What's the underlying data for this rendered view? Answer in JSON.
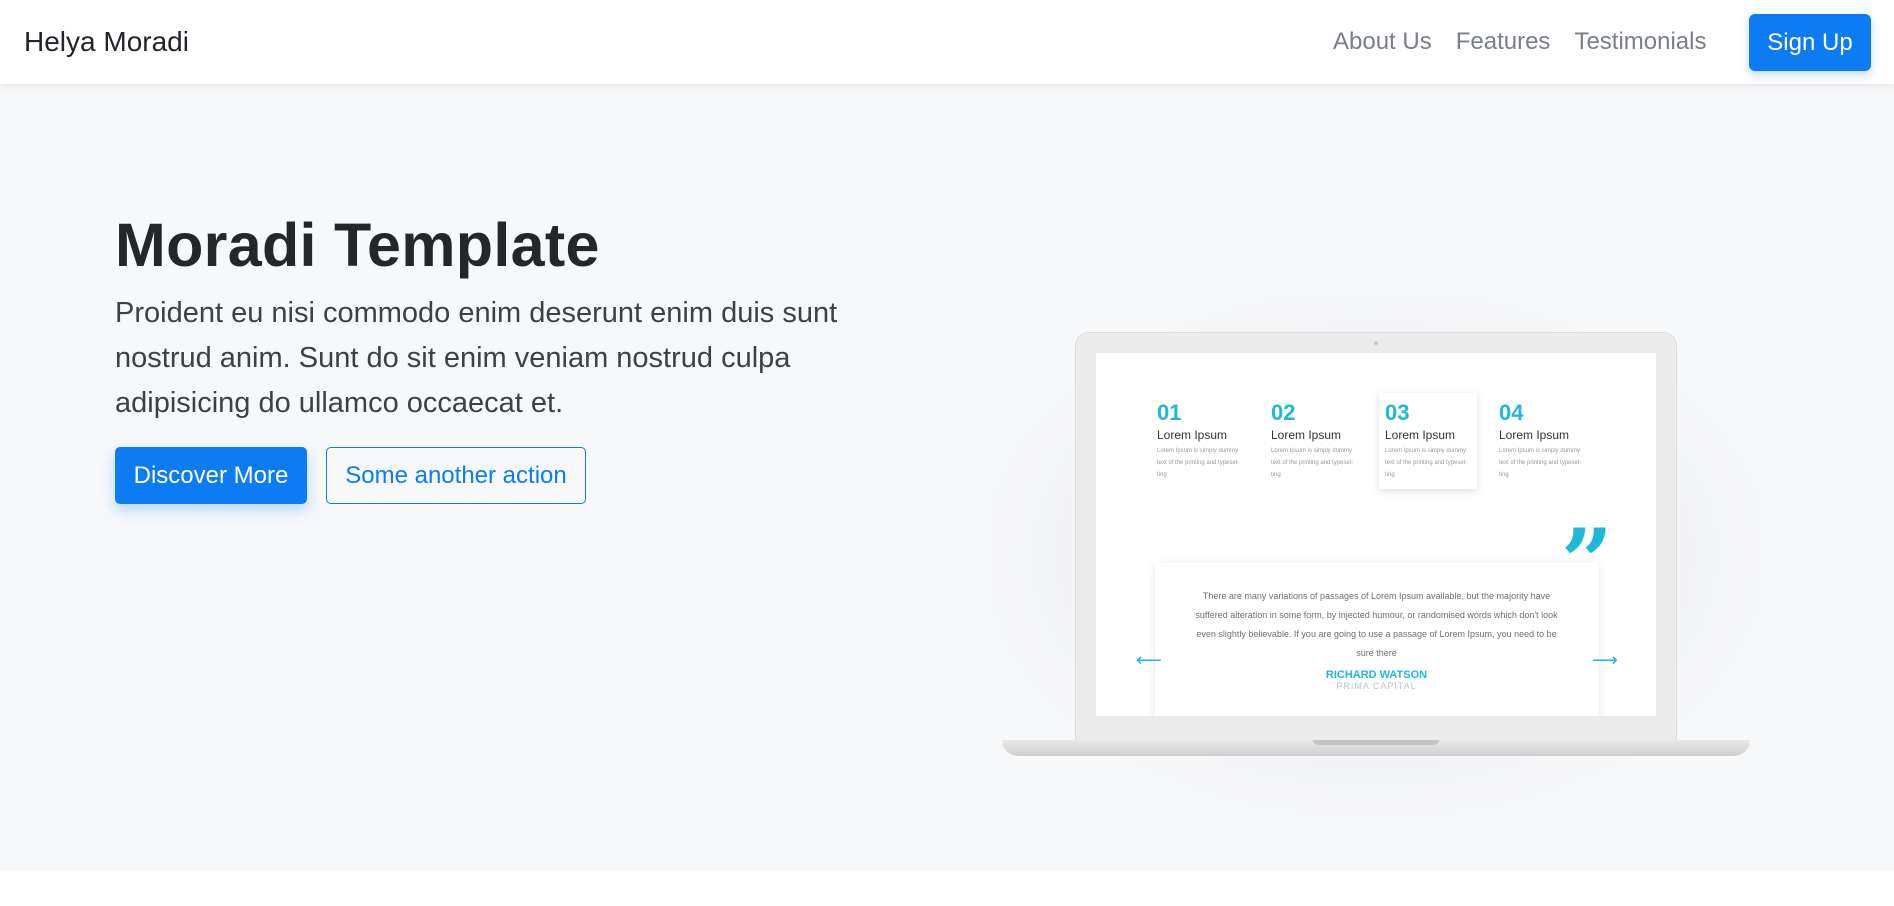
{
  "navbar": {
    "brand": "Helya Moradi",
    "links": [
      "About Us",
      "Features",
      "Testimonials"
    ],
    "signup_label": "Sign Up"
  },
  "hero": {
    "title": "Moradi Template",
    "text": "Proident eu nisi commodo enim deserunt enim duis sunt nostrud anim. Sunt do sit enim veniam nostrud culpa adipisicing do ullamco occaecat et.",
    "primary_label": "Discover More",
    "secondary_label": "Some another action"
  },
  "mockup": {
    "steps": [
      {
        "num": "01",
        "title": "Lorem Ipsum",
        "body": "Lorem Ipsum is simply dummy text of the printing and typeset-ting"
      },
      {
        "num": "02",
        "title": "Lorem Ipsum",
        "body": "Lorem Ipsum is simply dummy text of the printing and typeset-ting"
      },
      {
        "num": "03",
        "title": "Lorem Ipsum",
        "body": "Lorem Ipsum is simply dummy text of the printing and typeset-ting"
      },
      {
        "num": "04",
        "title": "Lorem Ipsum",
        "body": "Lorem Ipsum is simply dummy text of the printing and typeset-ting"
      }
    ],
    "quote": {
      "text": "There are many variations of passages of Lorem Ipsum available, but the majority have suffered alteration in some form, by injected humour, or randomised words which don't look even slightly believable. If you are going to use a passage of Lorem Ipsum, you need to be sure there",
      "name": "RICHARD WATSON",
      "company": "PRIMA CAPITAL"
    },
    "quote_mark": "”",
    "arrow_left": "⟵",
    "arrow_right": "⟶"
  },
  "colors": {
    "primary": "#0d7cf2",
    "accent": "#1fb8d6",
    "hero_bg": "#f7f8fa"
  }
}
